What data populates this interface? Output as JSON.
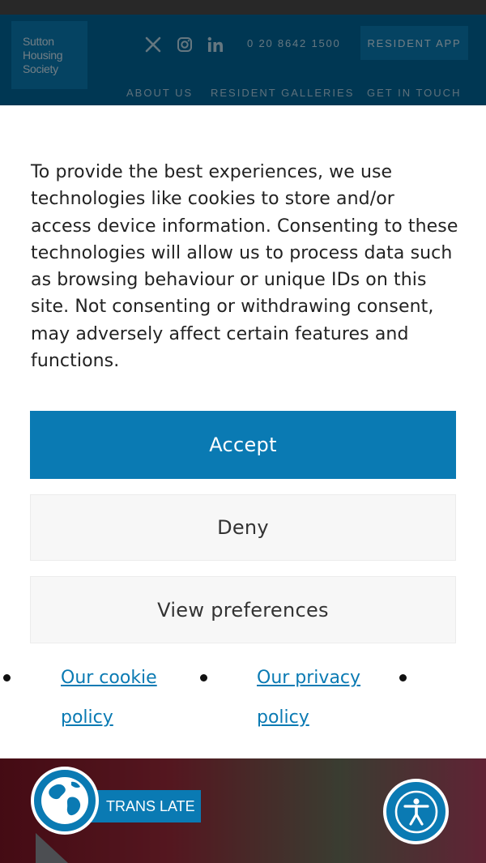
{
  "header": {
    "logo_lines": [
      "Sutton",
      "Housing",
      "Society"
    ],
    "social_icons": [
      "x-icon",
      "instagram-icon",
      "linkedin-icon"
    ],
    "phone": "0 20 8642 1500",
    "resident_app": "RESIDENT APP",
    "nav": [
      "ABOUT US",
      "RESIDENT GALLERIES",
      "GET IN TOUCH"
    ]
  },
  "consent": {
    "text": "To provide the best experiences, we use technologies like cookies to store and/or access device information. Consenting to these technologies will allow us to process data such as browsing behaviour or unique IDs on this site. Not consenting or withdrawing consent, may adversely affect certain features and functions.",
    "accept": "Accept",
    "deny": "Deny",
    "view_preferences": "View preferences",
    "links": [
      "Our cookie policy",
      "Our privacy policy"
    ]
  },
  "widgets": {
    "translate": "TRANS LATE",
    "translate_icon": "globe-icon",
    "accessibility_icon": "accessibility-icon"
  },
  "colors": {
    "brand_blue": "#0a7ab3",
    "header_blue": "#006497"
  }
}
